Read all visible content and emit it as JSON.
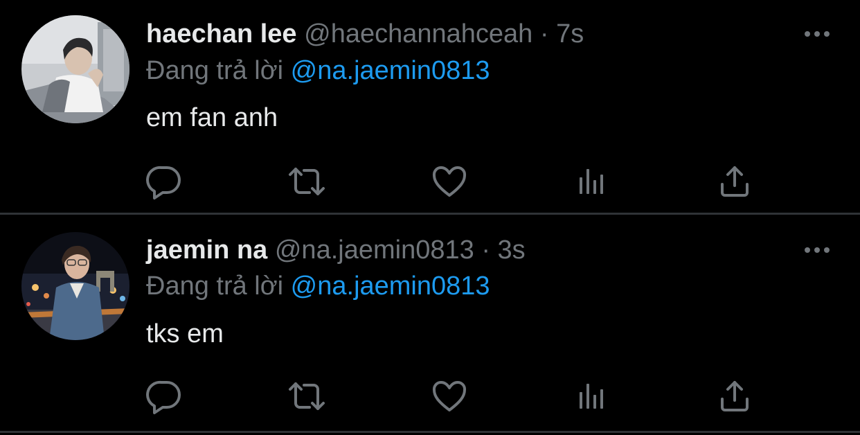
{
  "tweets": [
    {
      "display_name": "haechan lee",
      "handle": "@haechannahceah",
      "separator": "·",
      "time": "7s",
      "reply_prefix": "Đang trả lời",
      "reply_to": "@na.jaemin0813",
      "text": "em fan anh",
      "avatar_icon": "profile-photo"
    },
    {
      "display_name": "jaemin na",
      "handle": "@na.jaemin0813",
      "separator": "·",
      "time": "3s",
      "reply_prefix": "Đang trả lời",
      "reply_to": "@na.jaemin0813",
      "text": "tks em",
      "avatar_icon": "profile-photo"
    }
  ],
  "action_icons": [
    "reply-icon",
    "retweet-icon",
    "like-icon",
    "views-icon",
    "share-icon"
  ],
  "colors": {
    "background": "#000000",
    "primary_text": "#e7e9ea",
    "secondary_text": "#71767b",
    "link": "#1d9bf0",
    "divider": "#2f3336"
  }
}
